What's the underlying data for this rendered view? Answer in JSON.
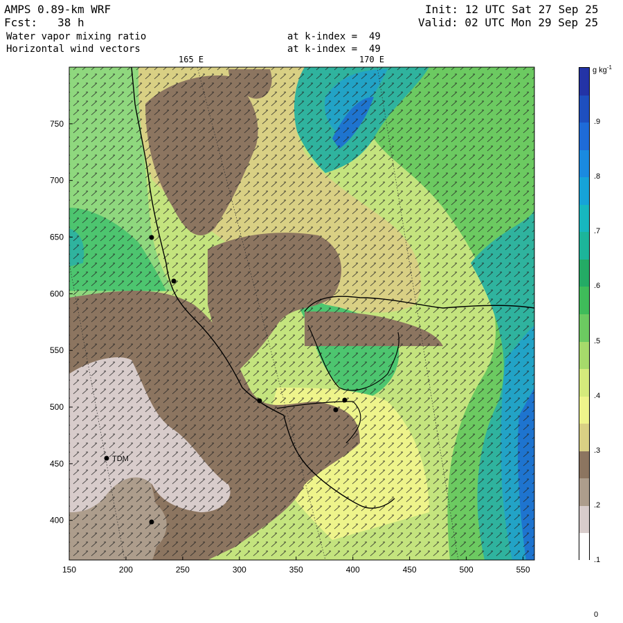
{
  "header": {
    "model": "AMPS 0.89-km WRF",
    "forecast": "Fcst:   38 h",
    "init": "Init: 12 UTC Sat 27 Sep 25",
    "valid": "Valid: 02 UTC Mon 29 Sep 25",
    "field1": "Water vapor mixing ratio",
    "field2": "Horizontal wind vectors",
    "kindex1": "at k-index =  49",
    "kindex2": "at k-index =  49"
  },
  "map": {
    "longitude_labels": [
      "165 E",
      "170 E"
    ],
    "x_ticks": [
      "150",
      "200",
      "250",
      "300",
      "350",
      "400",
      "450",
      "500",
      "550"
    ],
    "y_ticks": [
      "750",
      "700",
      "650",
      "600",
      "550",
      "500",
      "450",
      "400"
    ],
    "x_range": [
      150,
      560
    ],
    "y_range": [
      365,
      800
    ],
    "station_label": "TDM",
    "colors": {
      "brown_dark": "#8c7560",
      "brown_light": "#ad9d8c",
      "grey": "#d8cccb",
      "tan": "#d9d084",
      "yellow": "#eef48b",
      "lime": "#c4e47e",
      "green_light": "#8fd87e",
      "green": "#4dc56f",
      "teal": "#2fb39e",
      "cyan": "#22a3c6",
      "blue": "#1e74cf"
    }
  },
  "colorbar": {
    "unit": "g kg",
    "unit_exp": "-1",
    "labels": [
      ".9",
      ".8",
      ".7",
      ".6",
      ".5",
      ".4",
      ".3",
      ".2",
      ".1",
      "0"
    ],
    "segment_colors": [
      "#2333a6",
      "#1e4fbf",
      "#1e6bd8",
      "#1a8ae0",
      "#16a3d8",
      "#17b7bf",
      "#1cb59a",
      "#24ab65",
      "#3fbc5a",
      "#6cca61",
      "#a6da6b",
      "#d4ea7c",
      "#eef48b",
      "#d9d084",
      "#8c7560",
      "#ad9d8c",
      "#d8cccb",
      "#ffffff"
    ]
  }
}
